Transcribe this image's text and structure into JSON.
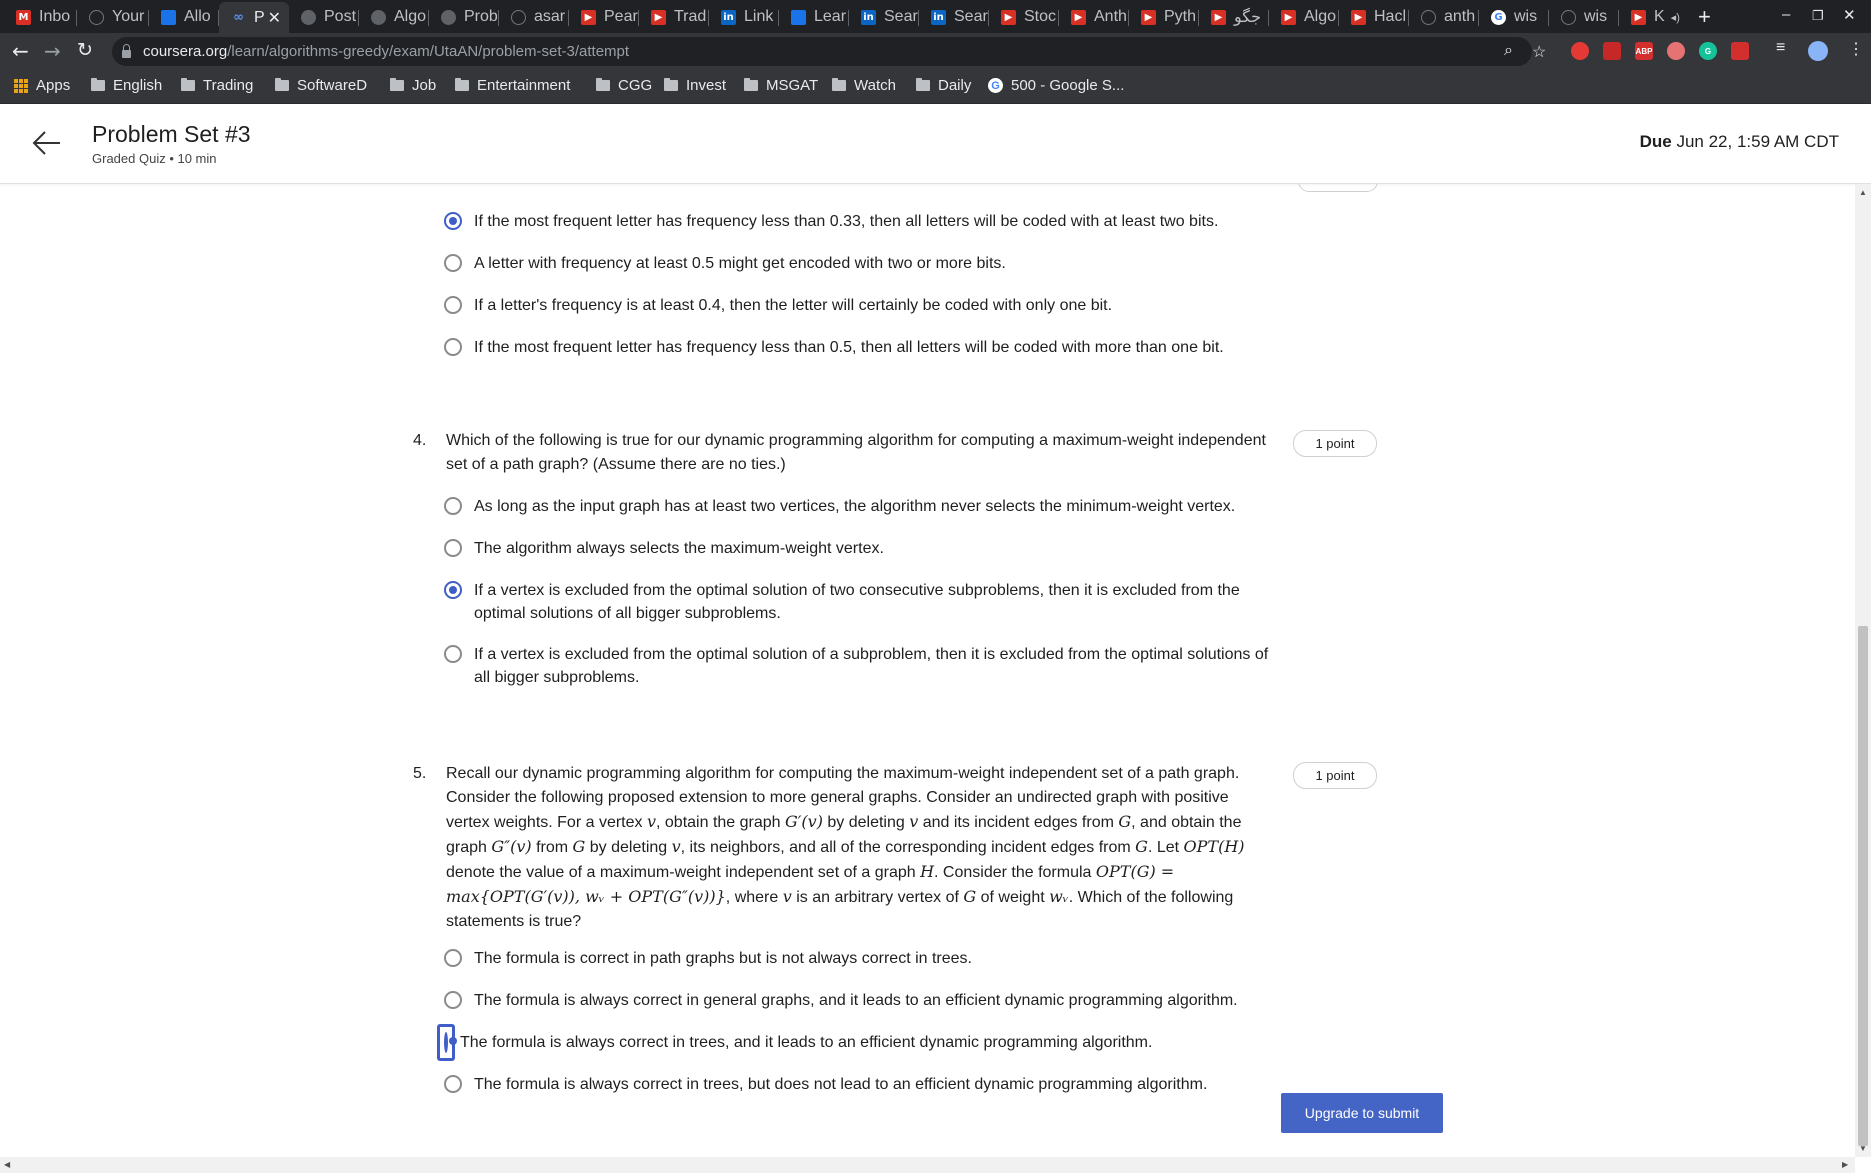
{
  "browser": {
    "tabs": [
      {
        "label": "Inbo",
        "icon": "gmail-icon"
      },
      {
        "label": "Your",
        "icon": "github-icon"
      },
      {
        "label": "Allo",
        "icon": "app-icon"
      },
      {
        "label": "P",
        "icon": "coursera-icon",
        "active": true
      },
      {
        "label": "Post",
        "icon": "user-icon"
      },
      {
        "label": "Algo",
        "icon": "user-icon"
      },
      {
        "label": "Prob",
        "icon": "user-icon"
      },
      {
        "label": "asar",
        "icon": "github-icon"
      },
      {
        "label": "Pear",
        "icon": "youtube-icon"
      },
      {
        "label": "Trad",
        "icon": "youtube-icon"
      },
      {
        "label": "Link",
        "icon": "linkedin-icon"
      },
      {
        "label": "Lear",
        "icon": "app-icon"
      },
      {
        "label": "Sear",
        "icon": "linkedin-icon"
      },
      {
        "label": "Sear",
        "icon": "linkedin-icon"
      },
      {
        "label": "Stoc",
        "icon": "youtube-icon"
      },
      {
        "label": "Anth",
        "icon": "youtube-icon"
      },
      {
        "label": "Pyth",
        "icon": "youtube-icon"
      },
      {
        "label": "جگو",
        "icon": "youtube-icon"
      },
      {
        "label": "Algo",
        "icon": "youtube-icon"
      },
      {
        "label": "Hacl",
        "icon": "youtube-icon"
      },
      {
        "label": "anth",
        "icon": "github-icon"
      },
      {
        "label": "wis",
        "icon": "google-icon"
      },
      {
        "label": "wis",
        "icon": "github-icon"
      },
      {
        "label": "K",
        "icon": "youtube-icon"
      }
    ],
    "url_host": "coursera.org",
    "url_path": "/learn/algorithms-greedy/exam/UtaAN/problem-set-3/attempt",
    "bookmarks": [
      "Apps",
      "English",
      "Trading",
      "SoftwareD",
      "Job",
      "Entertainment",
      "CGG",
      "Invest",
      "MSGAT",
      "Watch",
      "Daily",
      "500 - Google S..."
    ]
  },
  "header": {
    "title": "Problem Set #3",
    "subtitle": "Graded Quiz • 10 min",
    "due_label": "Due",
    "due_value": "Jun 22, 1:59 AM CDT"
  },
  "q3": {
    "options": [
      {
        "text": "If the most frequent letter has frequency less than 0.33, then all letters will be coded with at least two bits.",
        "selected": true
      },
      {
        "text": "A letter with frequency at least 0.5 might get encoded with two or more bits.",
        "selected": false
      },
      {
        "text": "If a letter's frequency is at least 0.4, then the letter will certainly be coded with only one bit.",
        "selected": false
      },
      {
        "text": "If the most frequent letter has frequency less than 0.5, then all letters will be coded with more than one bit.",
        "selected": false
      }
    ]
  },
  "q4": {
    "number": "4.",
    "points": "1 point",
    "text": "Which of the following is true for our dynamic programming algorithm for computing a maximum-weight independent set of a path graph? (Assume there are no ties.)",
    "options": [
      {
        "text": "As long as the input graph has at least two vertices, the algorithm never selects the minimum-weight vertex.",
        "selected": false
      },
      {
        "text": "The algorithm always selects the maximum-weight vertex.",
        "selected": false
      },
      {
        "text": "If a vertex is excluded from the optimal solution of two consecutive subproblems, then it is excluded from the optimal solutions of all bigger subproblems.",
        "selected": true
      },
      {
        "text": "If a vertex is excluded from the optimal solution of a subproblem, then it is excluded from the optimal solutions of all bigger subproblems.",
        "selected": false
      }
    ]
  },
  "q5": {
    "number": "5.",
    "points": "1 point",
    "text_parts": {
      "p1": "Recall our dynamic programming algorithm for computing the maximum-weight independent set of a path graph. Consider the following proposed extension to more general graphs. Consider an undirected graph with positive vertex weights. For a vertex ",
      "v": "v",
      "p2": ", obtain the graph ",
      "gp": "G′(v)",
      "p3": " by deleting ",
      "p4": " and its incident edges from ",
      "g": "G",
      "p5": ", and obtain the graph ",
      "gpp": "G″(v)",
      "p6": " from ",
      "p7": " by deleting ",
      "p8": ", its neighbors, and all of the corresponding incident edges from ",
      "p9": ". Let ",
      "opth": "OPT(H)",
      "p10": " denote the value of a maximum-weight independent set of a graph ",
      "h": "H",
      "p11": ". Consider the formula ",
      "formula": "OPT(G) = max{OPT(G′(v)), wᵥ + OPT(G″(v))}",
      "p12": ", where ",
      "p13": " is an arbitrary vertex of ",
      "p14": " of weight ",
      "wv": "wᵥ",
      "p15": ". Which of the following statements is true?"
    },
    "options": [
      {
        "text": "The formula is correct in path graphs but is not always correct in trees.",
        "selected": false
      },
      {
        "text": "The formula is always correct in general graphs, and it leads to an efficient dynamic programming algorithm.",
        "selected": false
      },
      {
        "text": "The formula is always correct in trees, and it leads to an efficient dynamic programming algorithm.",
        "selected": true
      },
      {
        "text": "The formula is always correct in trees, but does not lead to an efficient dynamic programming algorithm.",
        "selected": false
      }
    ]
  },
  "submit_label": "Upgrade to submit"
}
